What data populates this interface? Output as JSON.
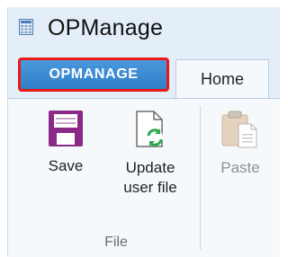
{
  "window": {
    "title": "OPManage",
    "app_icon": "grid-document-icon"
  },
  "tabs": {
    "file_tab": "OPMANAGE",
    "home_tab": "Home"
  },
  "ribbon": {
    "groups": [
      {
        "label": "File",
        "buttons": [
          {
            "label": "Save",
            "icon": "floppy-disk-icon"
          },
          {
            "label": "Update\nuser file",
            "icon": "document-refresh-icon"
          }
        ]
      }
    ],
    "next_button": {
      "label": "Paste",
      "icon": "clipboard-paste-icon",
      "state": "disabled"
    }
  },
  "colors": {
    "file_tab_bg": "#3d8ed6",
    "highlight": "#ea1919",
    "save_icon": "#8a2a86",
    "refresh_icon": "#2fa84f"
  }
}
